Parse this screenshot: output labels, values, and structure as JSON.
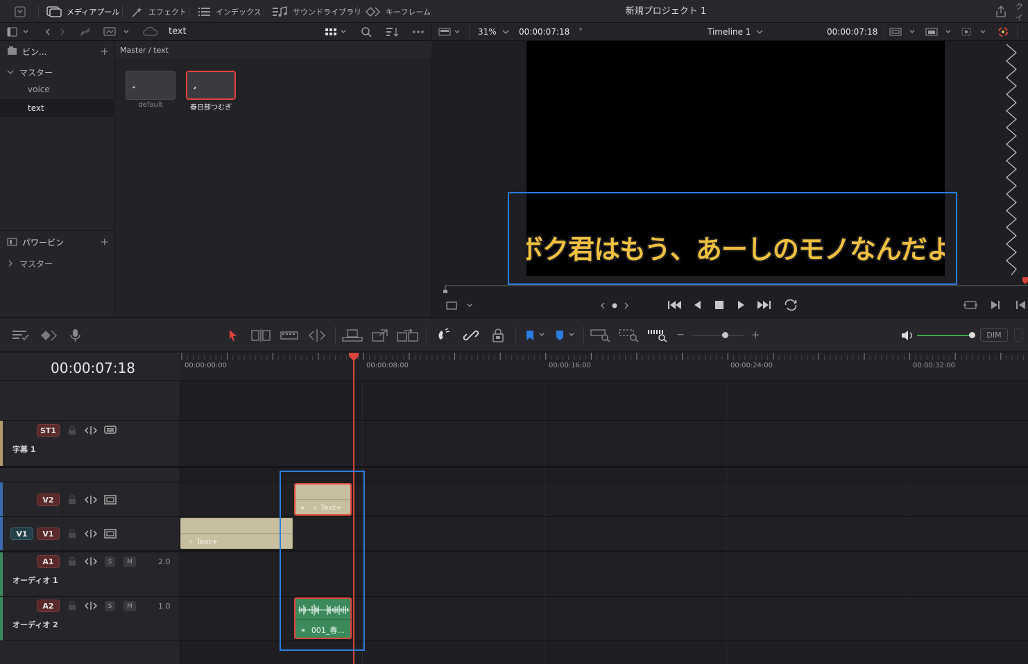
{
  "topbar": {
    "media_pool": "メディアプール",
    "effects": "エフェクト",
    "index": "インデックス",
    "sound_library": "サウンドライブラリ",
    "keyframes": "キーフレーム",
    "project_title": "新規プロジェクト 1",
    "right_cut": "クイ"
  },
  "secondbar": {
    "bin_name": "text",
    "zoom": "31%",
    "source_timecode": "00:00:07:18",
    "timeline_name": "Timeline 1",
    "record_timecode": "00:00:07:18"
  },
  "bins": {
    "bins_label": "ビン...",
    "master_label": "マスター",
    "items": [
      {
        "label": "voice"
      },
      {
        "label": "text"
      }
    ],
    "power_bins_label": "パワービン",
    "power_master_label": "マスター"
  },
  "media": {
    "breadcrumb": "Master / text",
    "clips": [
      {
        "label": "default"
      },
      {
        "label": "春日部つむぎ"
      }
    ]
  },
  "viewer": {
    "subtitle": "ボク君はもう、あーしのモノなんだよ"
  },
  "timeline": {
    "timecode": "00:00:07:18",
    "ticks": [
      "00:00:00:00",
      "00:00:08:00",
      "00:00:16:00",
      "00:00:24:00",
      "00:00:32:00"
    ],
    "volume_dim": "DIM",
    "tracks": {
      "st1": {
        "tag": "ST1",
        "name": "字幕 1"
      },
      "v2": {
        "tag": "V2"
      },
      "v1": {
        "tag": "V1",
        "source_tag": "V1"
      },
      "a1": {
        "tag": "A1",
        "name": "オーディオ 1",
        "level": "2.0",
        "solo": "S",
        "mute": "M"
      },
      "a2": {
        "tag": "A2",
        "name": "オーディオ 2",
        "level": "1.0",
        "solo": "S",
        "mute": "M"
      }
    },
    "clips": {
      "v2_clip": "Text+",
      "v1_clip": "Text+",
      "a2_clip": "001_春..."
    }
  },
  "colors": {
    "accent_blue": "#2a7de1",
    "playhead_red": "#d8453a",
    "title_clip": "#c8bfa0",
    "audio_clip": "#3c8a5c",
    "subtitle_text": "#f0c040"
  }
}
